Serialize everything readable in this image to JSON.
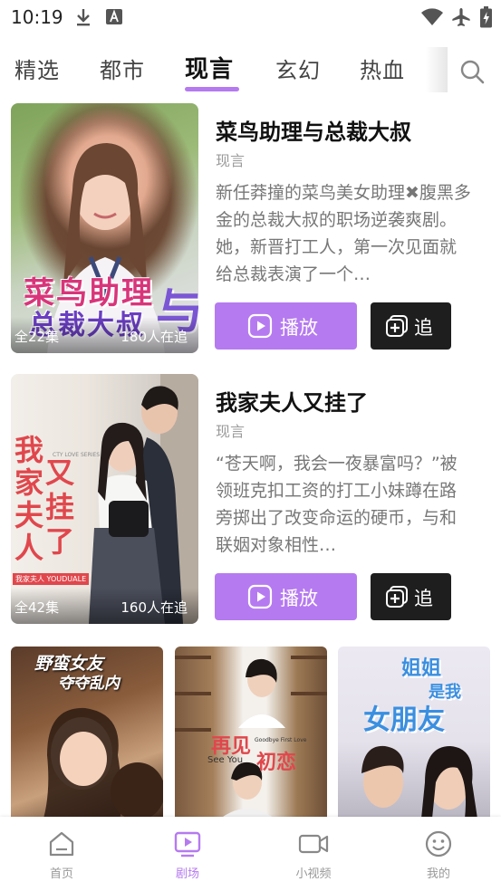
{
  "status_bar": {
    "time": "10:19",
    "left_icons": [
      "download-icon",
      "a-notification-icon"
    ],
    "right_icons": [
      "wifi-icon",
      "airplane-mode-icon",
      "battery-charging-icon"
    ]
  },
  "tabs": {
    "items": [
      {
        "label": "精选",
        "active": false
      },
      {
        "label": "都市",
        "active": false
      },
      {
        "label": "现言",
        "active": true
      },
      {
        "label": "玄幻",
        "active": false
      },
      {
        "label": "热血",
        "active": false
      }
    ],
    "search_icon": "search-icon"
  },
  "dramas": [
    {
      "title": "菜鸟助理与总裁大叔",
      "genre": "现言",
      "description": "新任莽撞的菜鸟美女助理✖腹黑多金的总裁大叔的职场逆袭爽剧。她，新晋打工人，第一次见面就给总裁表演了一个…",
      "episodes": "全22集",
      "viewers": "180人在追",
      "poster_title_line1": "菜鸟助理",
      "poster_title_line2": "总裁大叔",
      "poster_title_mark": "与",
      "play_label": "播放",
      "follow_label": "追"
    },
    {
      "title": "我家夫人又挂了",
      "genre": "现言",
      "description": "“苍天啊，我会一夜暴富吗？”被领班克扣工资的打工小妹蹲在路旁掷出了改变命运的硬币，与和联姻对象相性…",
      "episodes": "全42集",
      "viewers": "160人在追",
      "poster_title_line1": "我家",
      "poster_title_line2": "夫人",
      "poster_title_line3": "又挂了",
      "poster_caption": "CTY LOVE SERIES",
      "poster_tag": "我家夫人 YOUDUALE",
      "play_label": "播放",
      "follow_label": "追"
    }
  ],
  "thumbnails": [
    {
      "title_line1": "野蛮女友",
      "title_line2": "夺夺乱内"
    },
    {
      "title_line1": "再见",
      "title_line2": "初恋",
      "subtitle": "See You",
      "subtitle2": "Goodbye First Love"
    },
    {
      "title_line1": "姐姐",
      "title_line2": "是我",
      "title_line3": "女朋友"
    }
  ],
  "bottom_nav": [
    {
      "label": "首页",
      "icon": "home-icon",
      "active": false
    },
    {
      "label": "剧场",
      "icon": "theater-play-icon",
      "active": true
    },
    {
      "label": "小视频",
      "icon": "video-camera-icon",
      "active": false
    },
    {
      "label": "我的",
      "icon": "smiley-profile-icon",
      "active": false
    }
  ],
  "colors": {
    "accent": "#b57af0",
    "follow_button": "#1e1e1e",
    "muted_text": "#9a9a9a"
  }
}
